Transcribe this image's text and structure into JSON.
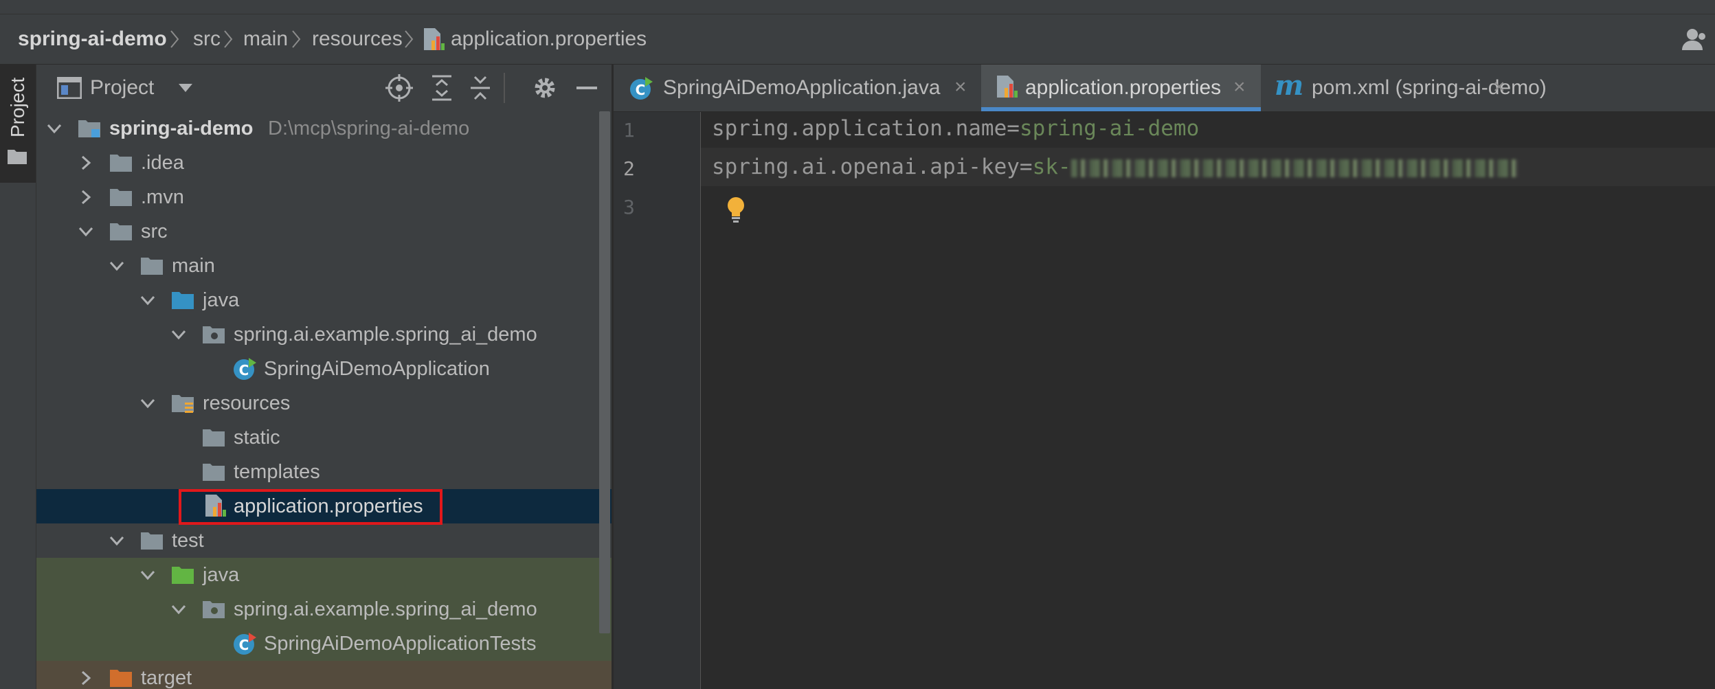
{
  "breadcrumb": {
    "project": "spring-ai-demo",
    "items": [
      "src",
      "main",
      "resources"
    ],
    "file": "application.properties"
  },
  "tool_stripe": {
    "project_label": "Project"
  },
  "project_panel": {
    "title": "Project",
    "tree": [
      {
        "label": "spring-ai-demo",
        "path": "D:\\mcp\\spring-ai-demo"
      },
      {
        "label": ".idea"
      },
      {
        "label": ".mvn"
      },
      {
        "label": "src"
      },
      {
        "label": "main"
      },
      {
        "label": "java"
      },
      {
        "label": "spring.ai.example.spring_ai_demo"
      },
      {
        "label": "SpringAiDemoApplication"
      },
      {
        "label": "resources"
      },
      {
        "label": "static"
      },
      {
        "label": "templates"
      },
      {
        "label": "application.properties"
      },
      {
        "label": "test"
      },
      {
        "label": "java"
      },
      {
        "label": "spring.ai.example.spring_ai_demo"
      },
      {
        "label": "SpringAiDemoApplicationTests"
      },
      {
        "label": "target"
      }
    ]
  },
  "tabs": [
    {
      "label": "SpringAiDemoApplication.java",
      "icon": "java-class-icon"
    },
    {
      "label": "application.properties",
      "icon": "properties-file-icon",
      "active": true
    },
    {
      "label": "pom.xml (spring-ai-demo)",
      "icon": "maven-icon"
    }
  ],
  "tab_close_glyph": "×",
  "editor": {
    "line_numbers": [
      "1",
      "2",
      "3"
    ],
    "lines": [
      {
        "key": "spring.application.name=",
        "value": "spring-ai-demo"
      },
      {
        "key": "spring.ai.openai.api-key=",
        "value": "sk-"
      }
    ]
  },
  "colors": {
    "accent": "#4a88c7",
    "highlight": "#e0181b",
    "selection": "#0d293e",
    "string_value": "#6a8759"
  }
}
